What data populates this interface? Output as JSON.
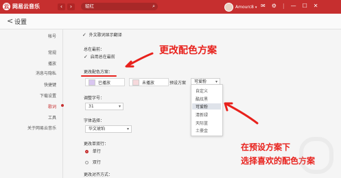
{
  "titlebar": {
    "app_name": "网易云音乐",
    "logo_glyph": "云",
    "back_glyph": "‹",
    "forward_glyph": "›",
    "search_value": "貂红",
    "username": "Amourc8",
    "icons": [
      "skin-icon",
      "mail-icon",
      "settings-icon",
      "minimize-icon",
      "maximize-icon",
      "close-icon"
    ],
    "icon_glyphs": [
      "✉",
      "⚙",
      "—",
      "☐",
      "✕"
    ],
    "accent_color": "#c62f2f"
  },
  "header": {
    "back_glyph": "<",
    "title": "设置"
  },
  "sidenav": {
    "items": [
      "帐号",
      "常规",
      "播放",
      "消息与隐私",
      "快捷键",
      "下载设置",
      "歌词",
      "工具",
      "关于网易云音乐"
    ],
    "active_index": 6
  },
  "content": {
    "foreign_translate_label": "外文歌词显示翻译",
    "always_top_title": "总在最前：",
    "always_top_label": "启用总在最前",
    "color_title": "更改配色方案：",
    "played_label": "已播放",
    "unplayed_label": "未播放",
    "preset_label": "预设方案",
    "preset_value": "可爱粉",
    "preset_options": [
      "自定义",
      "酷炫黑",
      "可爱粉",
      "清新绿",
      "天际蓝",
      "土豪金"
    ],
    "preset_selected_index": 2,
    "font_size_title": "调整字号：",
    "font_size_value": "31",
    "font_title": "字体选择：",
    "font_value": "华文琥珀",
    "lines_title": "更改单双行：",
    "single_line": "单行",
    "double_line": "双行",
    "align_title": "更改对齐方式："
  },
  "annotations": {
    "top": "更改配色方案",
    "bottom_line1": "在预设方案下",
    "bottom_line2": "选择喜欢的配色方案",
    "color": "#e8211c"
  }
}
